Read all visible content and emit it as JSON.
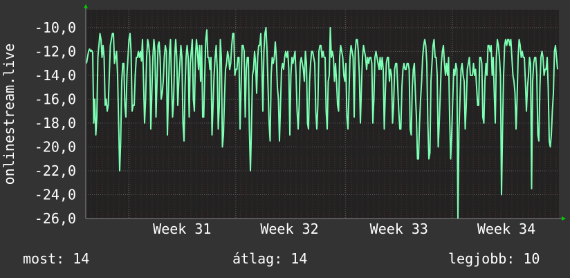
{
  "chart_data": {
    "type": "line",
    "ylabel": "onlinestream.live",
    "ylim": [
      -26,
      -8.5
    ],
    "yticks": [
      "-10,0",
      "-12,0",
      "-14,0",
      "-16,0",
      "-18,0",
      "-20,0",
      "-22,0",
      "-24,0",
      "-26,0"
    ],
    "ytick_values": [
      -10,
      -12,
      -14,
      -16,
      -18,
      -20,
      -22,
      -24,
      -26
    ],
    "xlim": [
      0,
      432
    ],
    "xticks": [
      {
        "label": "Week 31",
        "x": 88
      },
      {
        "label": "Week 32",
        "x": 186
      },
      {
        "label": "Week 33",
        "x": 286
      },
      {
        "label": "Week 34",
        "x": 384
      }
    ],
    "grid": true,
    "series": [
      {
        "color": "#7dffb4",
        "values": [
          -13.0,
          -12.5,
          -12.0,
          -11.8,
          -12.0,
          -11.9,
          -12.1,
          -18.0,
          -16.0,
          -19.0,
          -17.5,
          -12.5,
          -11.5,
          -10.5,
          -11.0,
          -12.5,
          -11.5,
          -12.5,
          -16.5,
          -16.0,
          -17.0,
          -16.5,
          -14.0,
          -11.5,
          -11.0,
          -10.5,
          -10.5,
          -13.0,
          -12.5,
          -12.0,
          -14.0,
          -18.0,
          -22.0,
          -19.5,
          -14.5,
          -13.0,
          -13.0,
          -16.5,
          -17.5,
          -14.0,
          -12.5,
          -11.0,
          -10.5,
          -12.0,
          -17.0,
          -16.5,
          -16.5,
          -14.0,
          -12.5,
          -12.5,
          -12.0,
          -12.5,
          -12.0,
          -12.8,
          -11.0,
          -14.5,
          -18.0,
          -16.0,
          -12.5,
          -11.0,
          -11.5,
          -12.5,
          -18.5,
          -15.5,
          -12.5,
          -11.0,
          -12.0,
          -17.5,
          -14.5,
          -11.5,
          -11.2,
          -12.5,
          -16.0,
          -15.5,
          -14.5,
          -12.5,
          -11.5,
          -12.0,
          -19.0,
          -15.5,
          -12.0,
          -11.0,
          -14.5,
          -17.5,
          -16.0,
          -12.5,
          -11.0,
          -12.5,
          -16.5,
          -14.5,
          -13.0,
          -11.5,
          -12.5,
          -18.0,
          -19.5,
          -15.0,
          -12.5,
          -11.5,
          -12.5,
          -17.5,
          -13.0,
          -12.0,
          -11.0,
          -16.0,
          -17.0,
          -12.5,
          -11.0,
          -12.0,
          -13.5,
          -11.5,
          -14.5,
          -11.5,
          -17.5,
          -17.5,
          -14.0,
          -11.0,
          -10.2,
          -12.5,
          -12.5,
          -13.5,
          -12.5,
          -19.0,
          -16.5,
          -14.0,
          -12.5,
          -11.5,
          -13.5,
          -18.5,
          -16.5,
          -11.0,
          -12.5,
          -20.0,
          -19.0,
          -16.0,
          -13.5,
          -13.0,
          -12.0,
          -12.5,
          -13.5,
          -13.0,
          -11.5,
          -10.5,
          -10.5,
          -14.0,
          -13.5,
          -13.5,
          -12.5,
          -12.5,
          -18.5,
          -15.0,
          -11.5,
          -11.5,
          -12.0,
          -17.5,
          -13.5,
          -12.5,
          -12.5,
          -18.5,
          -22.0,
          -18.5,
          -14.0,
          -13.5,
          -12.0,
          -13.0,
          -15.5,
          -12.5,
          -11.5,
          -11.5,
          -10.5,
          -13.0,
          -17.0,
          -12.0,
          -10.5,
          -10.0,
          -12.0,
          -15.0,
          -18.0,
          -19.5,
          -14.0,
          -12.5,
          -13.0,
          -12.5,
          -11.2,
          -12.5,
          -15.0,
          -16.0,
          -19.5,
          -16.5,
          -13.5,
          -13.0,
          -13.5,
          -12.5,
          -12.0,
          -12.5,
          -12.0,
          -13.5,
          -19.0,
          -14.0,
          -12.5,
          -13.0,
          -12.5,
          -12.0,
          -14.0,
          -17.0,
          -18.5,
          -16.5,
          -13.0,
          -12.5,
          -13.0,
          -13.5,
          -14.5,
          -12.0,
          -13.0,
          -18.0,
          -18.5,
          -14.5,
          -13.0,
          -12.0,
          -12.0,
          -12.5,
          -13.0,
          -17.0,
          -18.5,
          -16.5,
          -12.0,
          -11.5,
          -11.5,
          -12.5,
          -12.0,
          -12.5,
          -12.5,
          -17.0,
          -18.5,
          -14.5,
          -14.0,
          -10.0,
          -12.5,
          -12.0,
          -12.5,
          -14.5,
          -13.0,
          -14.5,
          -16.5,
          -17.0,
          -12.5,
          -11.5,
          -12.0,
          -12.5,
          -14.0,
          -14.5,
          -13.0,
          -17.5,
          -18.5,
          -15.5,
          -12.5,
          -11.5,
          -12.0,
          -12.5,
          -17.5,
          -12.0,
          -11.0,
          -11.0,
          -12.0,
          -14.0,
          -18.0,
          -15.0,
          -12.5,
          -11.5,
          -12.0,
          -12.5,
          -13.5,
          -12.5,
          -13.0,
          -12.5,
          -12.5,
          -13.0,
          -18.0,
          -16.0,
          -12.5,
          -12.0,
          -12.5,
          -13.0,
          -13.5,
          -12.5,
          -13.5,
          -12.5,
          -13.5,
          -18.5,
          -15.5,
          -13.0,
          -12.5,
          -12.5,
          -14.5,
          -13.5,
          -14.0,
          -18.0,
          -16.5,
          -13.5,
          -13.0,
          -13.0,
          -15.0,
          -17.0,
          -18.5,
          -18.5,
          -15.0,
          -13.5,
          -13.0,
          -13.5,
          -13.5,
          -13.0,
          -13.0,
          -13.5,
          -18.5,
          -19.0,
          -15.0,
          -13.5,
          -13.0,
          -15.5,
          -17.5,
          -21.0,
          -21.0,
          -18.0,
          -16.0,
          -14.5,
          -12.5,
          -11.5,
          -11.0,
          -11.5,
          -13.0,
          -18.0,
          -21.0,
          -20.5,
          -14.5,
          -13.0,
          -11.5,
          -11.0,
          -12.5,
          -12.5,
          -14.0,
          -20.0,
          -18.0,
          -15.5,
          -13.0,
          -12.0,
          -11.5,
          -13.0,
          -14.0,
          -13.0,
          -14.0,
          -12.5,
          -17.5,
          -21.0,
          -19.0,
          -16.0,
          -13.5,
          -14.0,
          -13.0,
          -13.5,
          -26.0,
          -18.5,
          -16.0,
          -13.5,
          -13.0,
          -14.0,
          -14.5,
          -18.5,
          -16.5,
          -13.5,
          -13.0,
          -12.5,
          -14.0,
          -14.0,
          -14.0,
          -13.0,
          -14.0,
          -13.5,
          -15.0,
          -16.5,
          -16.5,
          -12.5,
          -12.5,
          -13.0,
          -17.5,
          -18.0,
          -14.5,
          -13.0,
          -14.0,
          -11.5,
          -11.5,
          -12.0,
          -11.5,
          -14.0,
          -12.5,
          -15.5,
          -18.0,
          -12.5,
          -11.0,
          -11.5,
          -12.5,
          -14.0,
          -24.0,
          -18.5,
          -14.0,
          -11.5,
          -11.0,
          -11.5,
          -11.0,
          -11.0,
          -11.5,
          -11.0,
          -12.5,
          -14.0,
          -14.5,
          -15.5,
          -18.5,
          -16.0,
          -12.5,
          -11.0,
          -11.5,
          -12.5,
          -12.0,
          -12.5,
          -12.5,
          -14.5,
          -17.0,
          -15.0,
          -14.0,
          -12.5,
          -13.0,
          -23.5,
          -14.5,
          -13.0,
          -12.5,
          -12.5,
          -14.0,
          -19.0,
          -19.5,
          -15.0,
          -12.5,
          -12.0,
          -12.5,
          -14.0,
          -13.5,
          -13.5,
          -12.5,
          -15.0,
          -19.5,
          -20.0,
          -19.0,
          -17.0,
          -15.5,
          -12.0,
          -11.5,
          -12.5,
          -13.5
        ]
      }
    ]
  },
  "footer": {
    "last": "most: 14",
    "average": "átlag: 14",
    "best": "legjobb: 10"
  },
  "colors": {
    "background": "#333333",
    "plot_background": "#222222",
    "grid_minor": "#5a2a2a",
    "grid_major": "#5c5c5c",
    "line": "#7dffb4",
    "arrow": "#00cc00"
  }
}
